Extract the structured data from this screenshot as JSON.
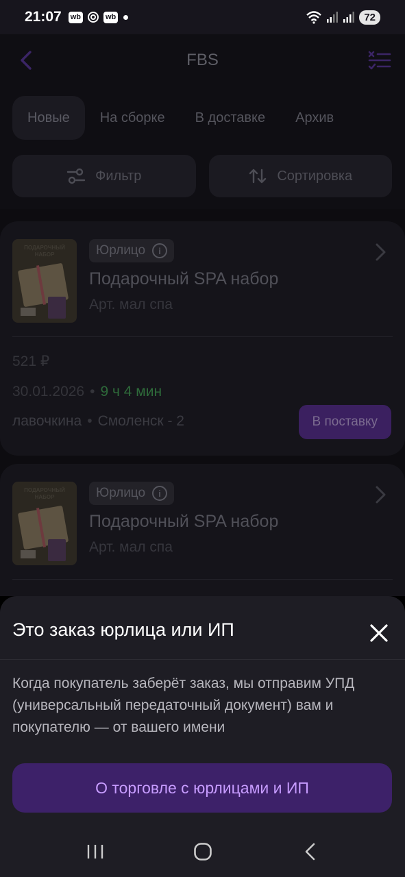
{
  "status_bar": {
    "time": "21:07",
    "notif_badge_1": "wb",
    "notif_badge_2": "wb",
    "battery": "72"
  },
  "header": {
    "title": "FBS",
    "back_icon": "chevron-left-icon",
    "select_icon": "list-checks-icon"
  },
  "tabs": [
    {
      "label": "Новые",
      "active": true
    },
    {
      "label": "На сборке",
      "active": false
    },
    {
      "label": "В доставке",
      "active": false
    },
    {
      "label": "Архив",
      "active": false
    }
  ],
  "controls": {
    "filter_label": "Фильтр",
    "sort_label": "Сортировка"
  },
  "orders": [
    {
      "chip": "Юрлицо",
      "name": "Подарочный SPA набор",
      "article": "Арт. мал спа",
      "thumb_text": "ПОДАРОЧНЫЙ НАБОР",
      "price": "521 ₽",
      "date": "30.01.2026",
      "timer": "9 ч 4 мин",
      "address": "лавочкина",
      "warehouse": "Смоленск - 2",
      "action_label": "В поставку"
    },
    {
      "chip": "Юрлицо",
      "name": "Подарочный SPA набор",
      "article": "Арт. мал спа",
      "thumb_text": "ПОДАРОЧНЫЙ НАБОР"
    }
  ],
  "sheet": {
    "title": "Это заказ юрлица или ИП",
    "text": "Когда покупатель заберёт заказ, мы отправим УПД (универсальный передаточный документ) вам и покупателю — от вашего имени",
    "button_label": "О торговле с юрлицами и ИП"
  },
  "colors": {
    "accent": "#c79cff",
    "accent_bg": "#3d2169",
    "timer_green": "#2e6a3a"
  }
}
